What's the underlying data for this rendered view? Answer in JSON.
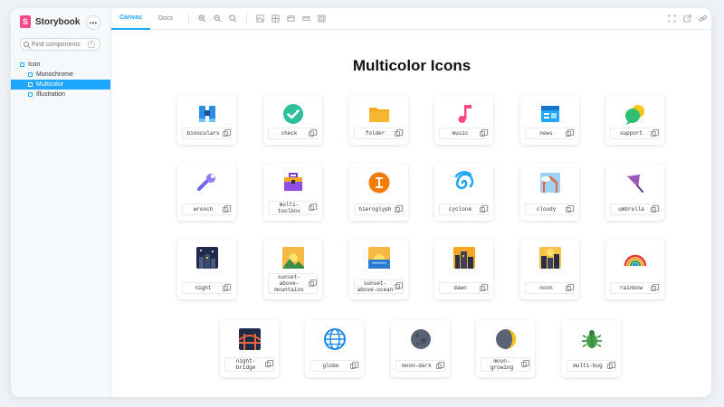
{
  "app": {
    "name": "Storybook",
    "logo_letter": "S",
    "menu_glyph": "•••"
  },
  "search": {
    "placeholder": "Find components",
    "shortcut": "/"
  },
  "tree": {
    "root": "Icon",
    "children": [
      "Monochrome",
      "Multicolor",
      "Illustration"
    ],
    "active": "Multicolor"
  },
  "toolbar": {
    "tabs": [
      "Canvas",
      "Docs"
    ],
    "active_tab": "Canvas",
    "tools_left": [
      "zoom-in-icon",
      "zoom-out-icon",
      "zoom-reset-icon",
      "background-icon",
      "grid-icon",
      "viewport-icon",
      "measure-icon",
      "outline-icon"
    ],
    "tools_right": [
      "fullscreen-icon",
      "open-new-tab-icon",
      "copy-link-icon"
    ]
  },
  "main": {
    "title": "Multicolor Icons",
    "icons": [
      {
        "label": "binoculars"
      },
      {
        "label": "check"
      },
      {
        "label": "folder"
      },
      {
        "label": "music"
      },
      {
        "label": "news"
      },
      {
        "label": "support"
      },
      {
        "label": "wrench"
      },
      {
        "label": "multi-\ntoolbox"
      },
      {
        "label": "hieroglyph"
      },
      {
        "label": "cyclone"
      },
      {
        "label": "cloudy"
      },
      {
        "label": "umbrella"
      },
      {
        "label": "night"
      },
      {
        "label": "sunset-\nabove-\nmountains"
      },
      {
        "label": "sunset-\nabove-ocean"
      },
      {
        "label": "dawn"
      },
      {
        "label": "noon"
      },
      {
        "label": "rainbow"
      },
      {
        "label": "night-\nbridge"
      },
      {
        "label": "globe"
      },
      {
        "label": "moon-dark"
      },
      {
        "label": "moon-\ngrowing"
      },
      {
        "label": "multi-bug"
      }
    ]
  },
  "colors": {
    "accent": "#1ea7fd",
    "brand": "#ff4785"
  }
}
